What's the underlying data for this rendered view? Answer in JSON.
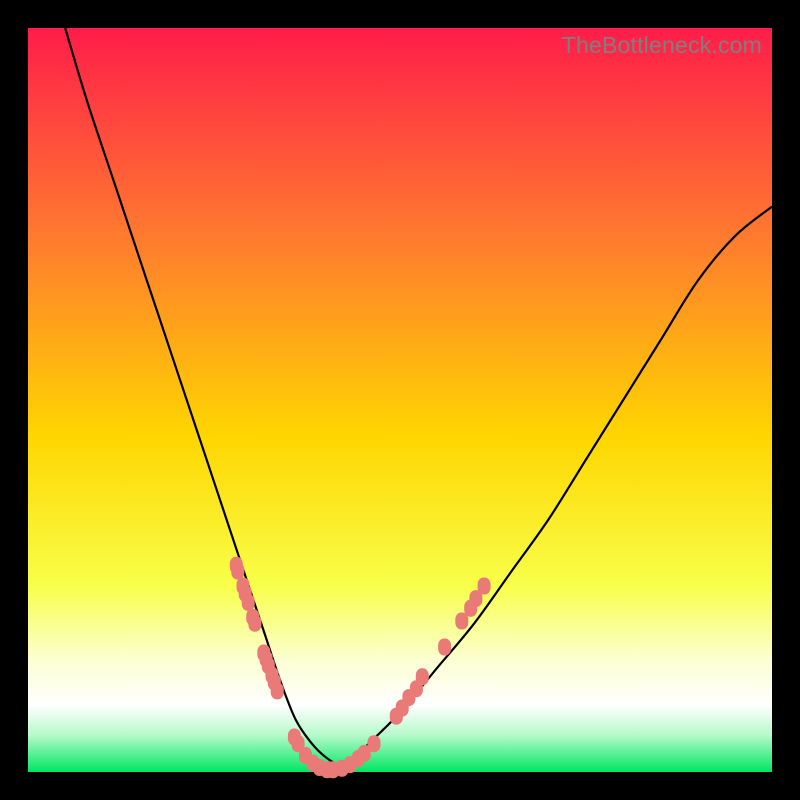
{
  "watermark": {
    "text": "TheBottleneck.com"
  },
  "colors": {
    "gradient_top": "#ff1d4a",
    "gradient_upper_mid": "#ff7a2f",
    "gradient_mid": "#ffd600",
    "gradient_lower_mid": "#f8ff4a",
    "gradient_pale": "#fbffd2",
    "gradient_white": "#ffffff",
    "gradient_mint": "#b6facb",
    "gradient_green": "#00e760",
    "curve_stroke": "#000000",
    "marker_fill": "#ea7a77",
    "background": "#000000"
  },
  "chart_data": {
    "type": "line",
    "title": "",
    "xlabel": "",
    "ylabel": "",
    "xlim": [
      0,
      100
    ],
    "ylim": [
      0,
      100
    ],
    "grid": false,
    "legend": false,
    "series": [
      {
        "name": "bottleneck-curve",
        "x": [
          5,
          8,
          12,
          16,
          20,
          24,
          28,
          30,
          32,
          34,
          36,
          38,
          40,
          42,
          44,
          46,
          50,
          55,
          60,
          65,
          70,
          75,
          80,
          85,
          90,
          95,
          100
        ],
        "y": [
          100,
          90,
          78,
          66,
          54,
          42,
          30,
          24,
          18,
          12,
          7,
          4,
          2,
          1,
          2,
          4,
          8,
          14,
          20,
          27,
          34,
          42,
          50,
          58,
          66,
          72,
          76
        ]
      }
    ],
    "markers": [
      {
        "x": 28.0,
        "y": 27.8
      },
      {
        "x": 28.2,
        "y": 27.0
      },
      {
        "x": 28.9,
        "y": 25.0
      },
      {
        "x": 29.2,
        "y": 24.0
      },
      {
        "x": 29.6,
        "y": 22.8
      },
      {
        "x": 30.2,
        "y": 20.8
      },
      {
        "x": 30.5,
        "y": 20.0
      },
      {
        "x": 31.7,
        "y": 16.0
      },
      {
        "x": 32.0,
        "y": 15.2
      },
      {
        "x": 32.3,
        "y": 14.3
      },
      {
        "x": 32.8,
        "y": 13.0
      },
      {
        "x": 33.1,
        "y": 12.1
      },
      {
        "x": 33.5,
        "y": 10.9
      },
      {
        "x": 35.8,
        "y": 4.7
      },
      {
        "x": 36.3,
        "y": 3.8
      },
      {
        "x": 37.3,
        "y": 2.2
      },
      {
        "x": 38.3,
        "y": 1.2
      },
      {
        "x": 39.2,
        "y": 0.6
      },
      {
        "x": 40.2,
        "y": 0.3
      },
      {
        "x": 41.0,
        "y": 0.3
      },
      {
        "x": 42.2,
        "y": 0.5
      },
      {
        "x": 43.3,
        "y": 1.0
      },
      {
        "x": 44.4,
        "y": 1.8
      },
      {
        "x": 45.2,
        "y": 2.5
      },
      {
        "x": 46.5,
        "y": 3.8
      },
      {
        "x": 49.5,
        "y": 7.5
      },
      {
        "x": 50.3,
        "y": 8.6
      },
      {
        "x": 51.2,
        "y": 10.0
      },
      {
        "x": 52.2,
        "y": 11.2
      },
      {
        "x": 53.0,
        "y": 12.8
      },
      {
        "x": 56.0,
        "y": 16.8
      },
      {
        "x": 58.3,
        "y": 20.3
      },
      {
        "x": 59.5,
        "y": 22.0
      },
      {
        "x": 60.2,
        "y": 23.3
      },
      {
        "x": 61.3,
        "y": 25.0
      }
    ]
  }
}
